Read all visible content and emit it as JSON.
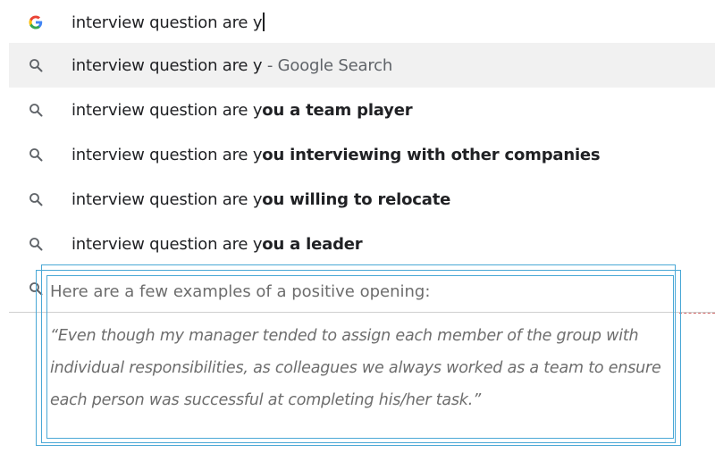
{
  "omnibox": {
    "typed_text": "interview question are y"
  },
  "suggestions": [
    {
      "prefix": "interview question are y",
      "bold": "",
      "suffix": " - Google Search",
      "selected": true
    },
    {
      "prefix": "interview question are y",
      "bold": "ou a team player",
      "suffix": "",
      "selected": false
    },
    {
      "prefix": "interview question are y",
      "bold": "ou interviewing with other companies",
      "suffix": "",
      "selected": false
    },
    {
      "prefix": "interview question are y",
      "bold": "ou willing to relocate",
      "suffix": "",
      "selected": false
    },
    {
      "prefix": "interview question are y",
      "bold": "ou a leader",
      "suffix": "",
      "selected": false
    }
  ],
  "article": {
    "intro": "Here are a few examples of a positive opening:",
    "quote_lines": [
      "“Even though my manager tended to assign each member of the group with",
      "individual responsibilities, as colleagues we always worked as a team to ensure",
      "each person was successful at completing his/her task.”"
    ]
  },
  "colors": {
    "selected_row_bg": "#f1f1f1",
    "frame_border": "#4aa8d6",
    "text_main": "#202124",
    "text_muted": "#6d6d6d"
  },
  "icons": {
    "omnibox": "google-g-icon",
    "suggestion": "search-icon"
  }
}
